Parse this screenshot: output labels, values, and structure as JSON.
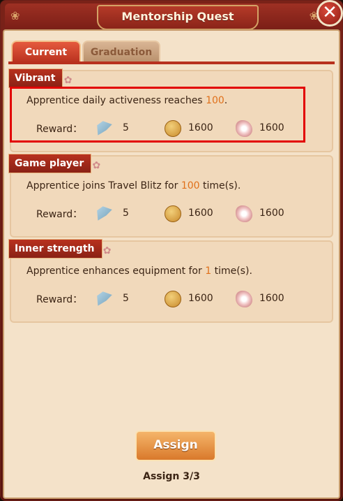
{
  "window": {
    "title": "Mentorship Quest",
    "close_label": "✕"
  },
  "tabs": [
    {
      "label": "Current",
      "active": true
    },
    {
      "label": "Graduation",
      "active": false
    }
  ],
  "quests": [
    {
      "tag": "Vibrant",
      "desc_prefix": "Apprentice daily activeness reaches ",
      "desc_value": "100",
      "desc_suffix": ".",
      "reward_label": "Reward：",
      "rewards": [
        {
          "icon": "fan-icon",
          "value": "5"
        },
        {
          "icon": "coin-icon",
          "value": "1600"
        },
        {
          "icon": "blossom-icon",
          "value": "1600"
        }
      ]
    },
    {
      "tag": "Game player",
      "desc_prefix": "Apprentice joins Travel Blitz for ",
      "desc_value": "100",
      "desc_suffix": " time(s).",
      "reward_label": "Reward：",
      "rewards": [
        {
          "icon": "fan-icon",
          "value": "5"
        },
        {
          "icon": "coin-icon",
          "value": "1600"
        },
        {
          "icon": "blossom-icon",
          "value": "1600"
        }
      ]
    },
    {
      "tag": "Inner strength",
      "desc_prefix": "Apprentice enhances equipment for ",
      "desc_value": "1",
      "desc_suffix": " time(s).",
      "reward_label": "Reward：",
      "rewards": [
        {
          "icon": "fan-icon",
          "value": "5"
        },
        {
          "icon": "coin-icon",
          "value": "1600"
        },
        {
          "icon": "blossom-icon",
          "value": "1600"
        }
      ]
    }
  ],
  "footer": {
    "assign_label": "Assign",
    "assign_status": "Assign 3/3"
  },
  "colors": {
    "highlight": "#e0701a",
    "accent_red": "#b8311e"
  }
}
